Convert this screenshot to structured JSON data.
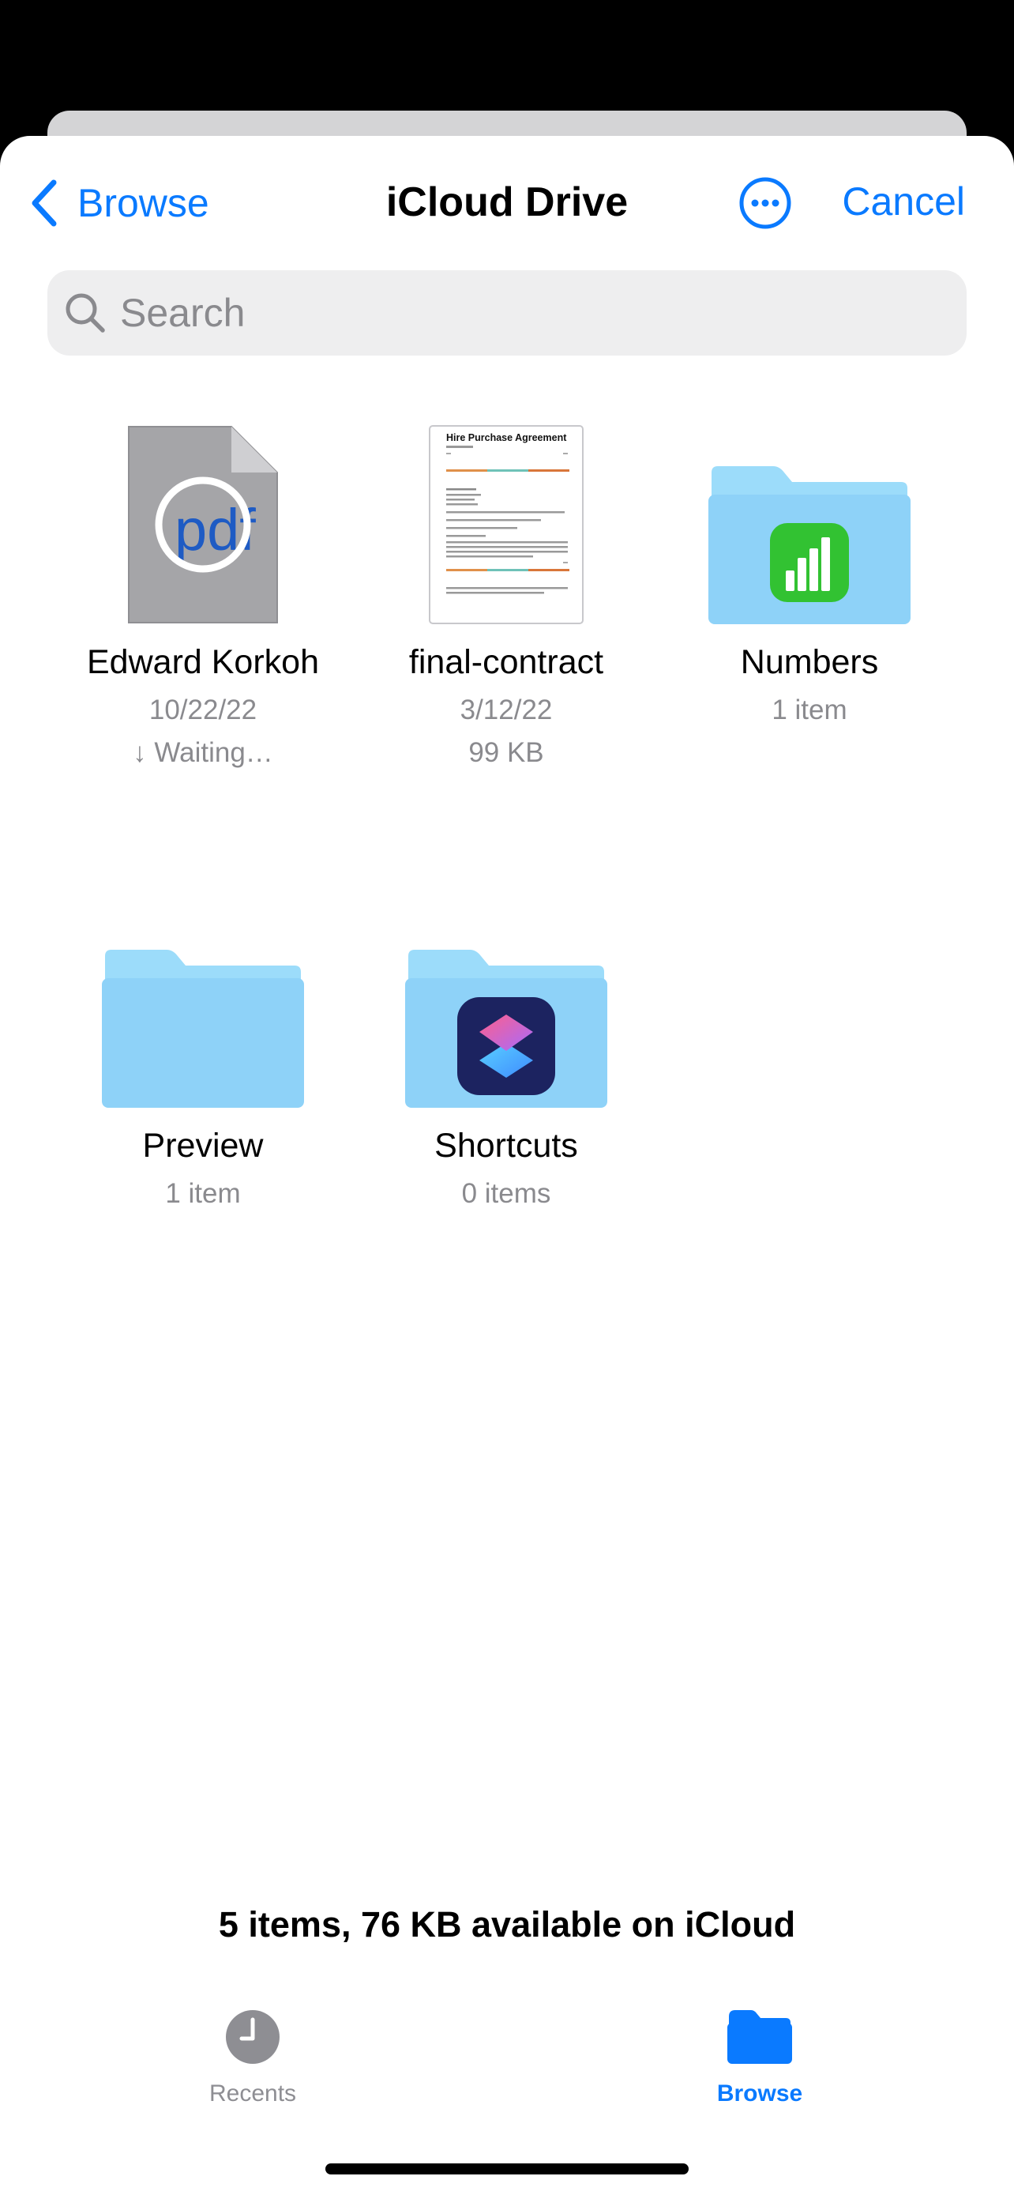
{
  "nav": {
    "back_label": "Browse",
    "title": "iCloud Drive",
    "more_icon": "ellipsis-circle-icon",
    "cancel_label": "Cancel"
  },
  "search": {
    "placeholder": "Search",
    "value": ""
  },
  "items": [
    {
      "name": "Edward Korkoh",
      "kind": "pdf-file",
      "line1": "10/22/22",
      "line2": "↓ Waiting…"
    },
    {
      "name": "final-contract",
      "kind": "document",
      "line1": "3/12/22",
      "line2": "99 KB",
      "preview_title": "Hire Purchase Agreement"
    },
    {
      "name": "Numbers",
      "kind": "folder",
      "line1": "1 item",
      "badge_icon": "numbers-app-icon"
    },
    {
      "name": "Preview",
      "kind": "folder",
      "line1": "1 item"
    },
    {
      "name": "Shortcuts",
      "kind": "folder",
      "line1": "0 items",
      "badge_icon": "shortcuts-app-icon"
    }
  ],
  "pdf_label": "pdf",
  "footer": {
    "summary": "5 items, 76 KB available on iCloud"
  },
  "tabs": [
    {
      "label": "Recents",
      "icon": "clock-icon",
      "active": false
    },
    {
      "label": "Browse",
      "icon": "folder-icon",
      "active": true
    }
  ],
  "colors": {
    "accent": "#0a7aff",
    "secondary_text": "#8a8a8e",
    "folder": "#8ed2f8",
    "inactive_tab": "#8e8e93"
  }
}
